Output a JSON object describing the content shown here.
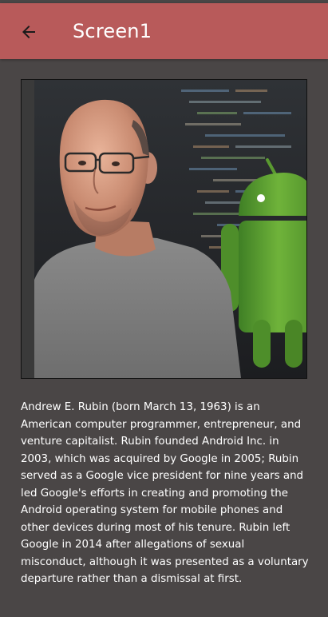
{
  "app_bar": {
    "title": "Screen1",
    "back_icon": "arrow-left-icon",
    "color": "#b85a5a"
  },
  "photo": {
    "subject": "portrait-with-android-robot"
  },
  "bio": {
    "text": "Andrew E. Rubin (born March 13, 1963) is an American computer programmer, entrepreneur, and venture capitalist. Rubin founded Android Inc. in 2003, which was acquired by Google in 2005; Rubin served as a Google vice president for nine years and led Google's efforts in creating and promoting the Android operating system for mobile phones and other devices during most of his tenure. Rubin left Google in 2014 after allegations of sexual misconduct,  although it was presented as a voluntary departure rather than a  dismissal at first."
  },
  "colors": {
    "background": "#4a4646",
    "text": "#ffffff"
  }
}
